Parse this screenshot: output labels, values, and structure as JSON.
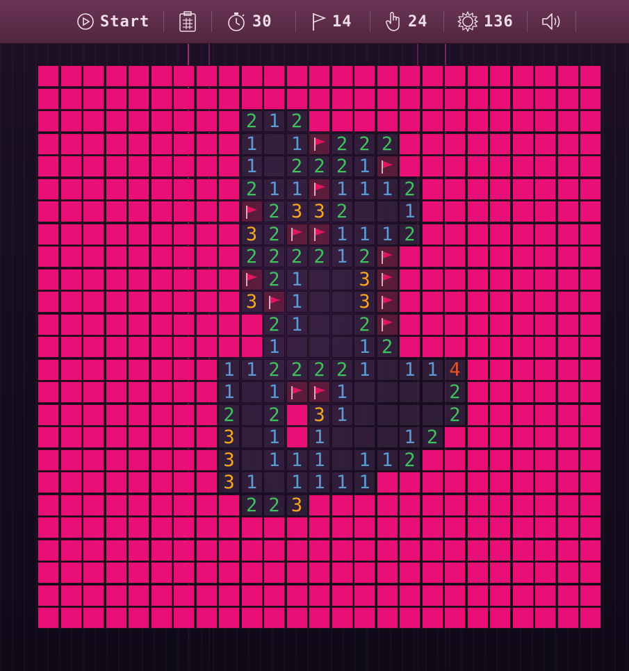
{
  "toolbar": {
    "start_label": "Start",
    "timer": "30",
    "flags": "14",
    "clicks": "24",
    "score": "136"
  },
  "icons": {
    "start": "play-circle-icon",
    "scoreboard": "scoreboard-icon",
    "timer": "stopwatch-icon",
    "flags": "flag-icon",
    "clicks": "hand-pointer-icon",
    "score": "gear-badge-icon",
    "sound": "speaker-icon"
  },
  "colors": {
    "hidden_tile": "#e90f77",
    "open_tile": "#3a2442",
    "num1": "#5b9ad3",
    "num2": "#3fc25e",
    "num3": "#f3a91e",
    "num4": "#e4532c",
    "flag": "#e21560"
  },
  "board": {
    "cols": 25,
    "rows": 25,
    "rows_data": [
      "#########################",
      "#########################",
      "#########212#############",
      "#########1.1F222#########",
      "#########1.2221F#########",
      "#########211F1112########",
      "#########F2332..1########",
      "#########32FF1112########",
      "#########222212F#########",
      "#########F21..3F#########",
      "#########3F1..3F#########",
      "##########21..2F#########",
      "##########1...12#########",
      "########1122221.114######",
      "########1.1FF1....2######",
      "########2.2#31....2######",
      "########3.1#1...12#######",
      "########3.111.112########",
      "########31.1111##########",
      "#########223#############",
      "#########################",
      "#########################",
      "#########################",
      "#########################",
      "#########################"
    ]
  }
}
